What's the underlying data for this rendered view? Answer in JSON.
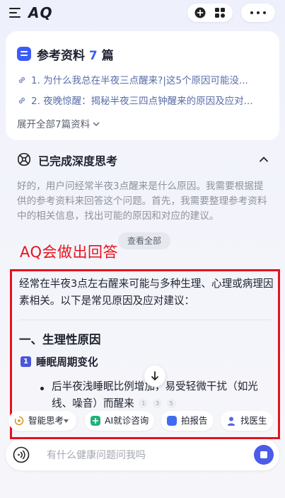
{
  "app": {
    "logo": "AQ"
  },
  "references": {
    "title_prefix": "参考资料",
    "count": "7",
    "title_suffix": "篇",
    "items": [
      "1. 为什么我总在半夜三点醒来?|这5个原因可能没...",
      "2. 夜晚惊醒：揭秘半夜三四点钟醒来的原因及应对..."
    ],
    "expand_label": "展开全部7篇资料"
  },
  "thinking": {
    "title": "已完成深度思考",
    "text": "好的，用户问经常半夜3点醒来是什么原因。我需要根据提供的参考资料来回答这个问题。首先，我需要整理参考资料中的相关信息，找出可能的原因和对应的建议。",
    "see_all": "查看全部"
  },
  "annotation": "AQ会做出回答",
  "answer": {
    "intro": "经常在半夜3点左右醒来可能与多种生理、心理或病理因素相关。以下是常见原因及应对建议：",
    "section_heading": "一、生理性原因",
    "sub_number": "1",
    "sub_heading": "睡眠周期变化",
    "bullet": "后半夜浅睡眠比例增加，易受轻微干扰（如光线、噪音）而醒来",
    "citations": [
      "1",
      "3",
      "5"
    ]
  },
  "quick_actions": {
    "smart_think": "智能思考",
    "ai_consult": "AI就诊咨询",
    "report": "拍报告",
    "doctor": "找医生"
  },
  "input": {
    "placeholder": "有什么健康问题问我吗"
  },
  "colors": {
    "accent": "#3b5cf6",
    "annotation_red": "#e5131d",
    "send": "#4a5ce8"
  }
}
